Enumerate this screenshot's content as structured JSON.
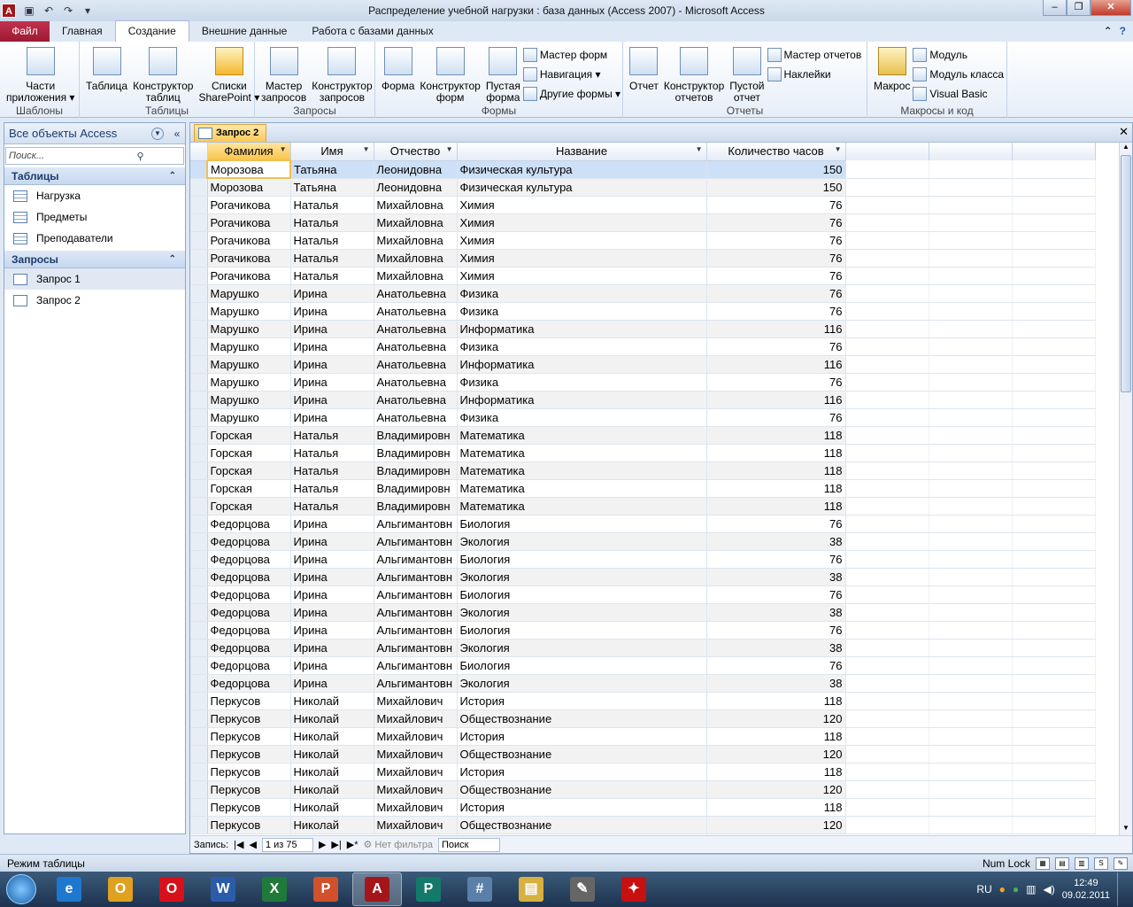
{
  "window": {
    "title": "Распределение учебной нагрузки : база данных (Access 2007)  -  Microsoft Access"
  },
  "ribbon_tabs": [
    {
      "label": "Файл",
      "kind": "file"
    },
    {
      "label": "Главная"
    },
    {
      "label": "Создание",
      "active": true
    },
    {
      "label": "Внешние данные"
    },
    {
      "label": "Работа с базами данных"
    }
  ],
  "ribbon_groups": {
    "templates": {
      "label": "Шаблоны",
      "buttons": [
        {
          "label": "Части\nприложения ▾"
        }
      ]
    },
    "tables": {
      "label": "Таблицы",
      "buttons": [
        {
          "label": "Таблица"
        },
        {
          "label": "Конструктор\nтаблиц"
        },
        {
          "label": "Списки\nSharePoint ▾"
        }
      ]
    },
    "queries": {
      "label": "Запросы",
      "buttons": [
        {
          "label": "Мастер\nзапросов"
        },
        {
          "label": "Конструктор\nзапросов"
        }
      ]
    },
    "forms": {
      "label": "Формы",
      "buttons": [
        {
          "label": "Форма"
        },
        {
          "label": "Конструктор\nформ"
        },
        {
          "label": "Пустая\nформа"
        }
      ],
      "small": [
        {
          "label": "Мастер форм"
        },
        {
          "label": "Навигация ▾"
        },
        {
          "label": "Другие формы ▾"
        }
      ]
    },
    "reports": {
      "label": "Отчеты",
      "buttons": [
        {
          "label": "Отчет"
        },
        {
          "label": "Конструктор\nотчетов"
        },
        {
          "label": "Пустой\nотчет"
        }
      ],
      "small": [
        {
          "label": "Мастер отчетов"
        },
        {
          "label": "Наклейки"
        }
      ]
    },
    "macros": {
      "label": "Макросы и код",
      "buttons": [
        {
          "label": "Макрос"
        }
      ],
      "small": [
        {
          "label": "Модуль"
        },
        {
          "label": "Модуль класса"
        },
        {
          "label": "Visual Basic"
        }
      ]
    }
  },
  "nav_pane": {
    "header": "Все объекты Access",
    "search_placeholder": "Поиск...",
    "sections": [
      {
        "title": "Таблицы",
        "items": [
          "Нагрузка",
          "Предметы",
          "Преподаватели"
        ]
      },
      {
        "title": "Запросы",
        "items": [
          "Запрос 1",
          "Запрос 2"
        ]
      }
    ]
  },
  "document": {
    "tab": "Запрос 2",
    "columns": [
      "Фамилия",
      "Имя",
      "Отчество",
      "Название",
      "Количество часов"
    ],
    "rows": [
      [
        "Морозова",
        "Татьяна",
        "Леонидовна",
        "Физическая культура",
        "150"
      ],
      [
        "Морозова",
        "Татьяна",
        "Леонидовна",
        "Физическая культура",
        "150"
      ],
      [
        "Рогачикова",
        "Наталья",
        "Михайловна",
        "Химия",
        "76"
      ],
      [
        "Рогачикова",
        "Наталья",
        "Михайловна",
        "Химия",
        "76"
      ],
      [
        "Рогачикова",
        "Наталья",
        "Михайловна",
        "Химия",
        "76"
      ],
      [
        "Рогачикова",
        "Наталья",
        "Михайловна",
        "Химия",
        "76"
      ],
      [
        "Рогачикова",
        "Наталья",
        "Михайловна",
        "Химия",
        "76"
      ],
      [
        "Марушко",
        "Ирина",
        "Анатольевна",
        "Физика",
        "76"
      ],
      [
        "Марушко",
        "Ирина",
        "Анатольевна",
        "Физика",
        "76"
      ],
      [
        "Марушко",
        "Ирина",
        "Анатольевна",
        "Информатика",
        "116"
      ],
      [
        "Марушко",
        "Ирина",
        "Анатольевна",
        "Физика",
        "76"
      ],
      [
        "Марушко",
        "Ирина",
        "Анатольевна",
        "Информатика",
        "116"
      ],
      [
        "Марушко",
        "Ирина",
        "Анатольевна",
        "Физика",
        "76"
      ],
      [
        "Марушко",
        "Ирина",
        "Анатольевна",
        "Информатика",
        "116"
      ],
      [
        "Марушко",
        "Ирина",
        "Анатольевна",
        "Физика",
        "76"
      ],
      [
        "Горская",
        "Наталья",
        "Владимировн",
        "Математика",
        "118"
      ],
      [
        "Горская",
        "Наталья",
        "Владимировн",
        "Математика",
        "118"
      ],
      [
        "Горская",
        "Наталья",
        "Владимировн",
        "Математика",
        "118"
      ],
      [
        "Горская",
        "Наталья",
        "Владимировн",
        "Математика",
        "118"
      ],
      [
        "Горская",
        "Наталья",
        "Владимировн",
        "Математика",
        "118"
      ],
      [
        "Федорцова",
        "Ирина",
        "Альгимантовн",
        "Биология",
        "76"
      ],
      [
        "Федорцова",
        "Ирина",
        "Альгимантовн",
        "Экология",
        "38"
      ],
      [
        "Федорцова",
        "Ирина",
        "Альгимантовн",
        "Биология",
        "76"
      ],
      [
        "Федорцова",
        "Ирина",
        "Альгимантовн",
        "Экология",
        "38"
      ],
      [
        "Федорцова",
        "Ирина",
        "Альгимантовн",
        "Биология",
        "76"
      ],
      [
        "Федорцова",
        "Ирина",
        "Альгимантовн",
        "Экология",
        "38"
      ],
      [
        "Федорцова",
        "Ирина",
        "Альгимантовн",
        "Биология",
        "76"
      ],
      [
        "Федорцова",
        "Ирина",
        "Альгимантовн",
        "Экология",
        "38"
      ],
      [
        "Федорцова",
        "Ирина",
        "Альгимантовн",
        "Биология",
        "76"
      ],
      [
        "Федорцова",
        "Ирина",
        "Альгимантовн",
        "Экология",
        "38"
      ],
      [
        "Перкусов",
        "Николай",
        "Михайлович",
        "История",
        "118"
      ],
      [
        "Перкусов",
        "Николай",
        "Михайлович",
        "Обществознание",
        "120"
      ],
      [
        "Перкусов",
        "Николай",
        "Михайлович",
        "История",
        "118"
      ],
      [
        "Перкусов",
        "Николай",
        "Михайлович",
        "Обществознание",
        "120"
      ],
      [
        "Перкусов",
        "Николай",
        "Михайлович",
        "История",
        "118"
      ],
      [
        "Перкусов",
        "Николай",
        "Михайлович",
        "Обществознание",
        "120"
      ],
      [
        "Перкусов",
        "Николай",
        "Михайлович",
        "История",
        "118"
      ],
      [
        "Перкусов",
        "Николай",
        "Михайлович",
        "Обществознание",
        "120"
      ]
    ]
  },
  "record_nav": {
    "label": "Запись:",
    "position": "1 из 75",
    "filter": "Нет фильтра",
    "search": "Поиск"
  },
  "status": {
    "mode": "Режим таблицы",
    "numlock": "Num Lock",
    "view_icons": [
      "datasheet-view-icon",
      "pivot-table-icon",
      "pivot-chart-icon",
      "sql-view-icon"
    ]
  },
  "taskbar": {
    "apps": [
      {
        "name": "internet-explorer",
        "glyph": "e",
        "color": "#1e78d0"
      },
      {
        "name": "outlook",
        "glyph": "O",
        "color": "#e0a020"
      },
      {
        "name": "opera",
        "glyph": "O",
        "color": "#d8101c"
      },
      {
        "name": "word",
        "glyph": "W",
        "color": "#2a5caa"
      },
      {
        "name": "excel",
        "glyph": "X",
        "color": "#1f7a3a"
      },
      {
        "name": "powerpoint",
        "glyph": "P",
        "color": "#d2502a"
      },
      {
        "name": "access",
        "glyph": "A",
        "color": "#a4161a",
        "active": true
      },
      {
        "name": "publisher",
        "glyph": "P",
        "color": "#137a6a"
      },
      {
        "name": "calculator",
        "glyph": "#",
        "color": "#5a7fa8"
      },
      {
        "name": "explorer",
        "glyph": "▤",
        "color": "#d8b040"
      },
      {
        "name": "documents",
        "glyph": "✎",
        "color": "#666666"
      },
      {
        "name": "pdf",
        "glyph": "✦",
        "color": "#c81010"
      }
    ],
    "lang": "RU",
    "time": "12:49",
    "date": "09.02.2011"
  }
}
